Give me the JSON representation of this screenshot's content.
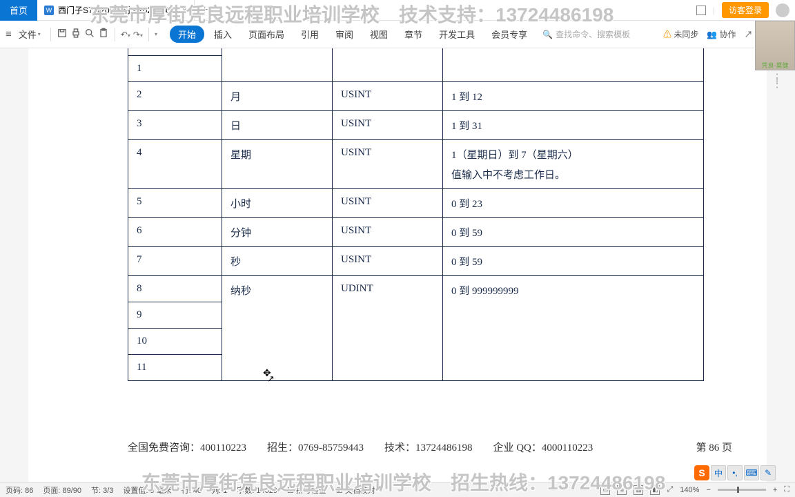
{
  "titlebar": {
    "home_tab": "首页",
    "doc_icon": "W",
    "doc_name": "西门子S7-1200教材 - 20210302",
    "login": "访客登录"
  },
  "toolbar": {
    "file": "文件",
    "tabs": {
      "start": "开始",
      "insert": "插入",
      "layout": "页面布局",
      "ref": "引用",
      "review": "审阅",
      "view": "视图",
      "chapter": "章节",
      "dev": "开发工具",
      "member": "会员专享"
    },
    "search_ph": "查找命令、搜索模板",
    "unsynced": "未同步",
    "collab": "协作",
    "share": "分享"
  },
  "watermark": {
    "top": "东莞市厚街凭良远程职业培训学校　技术支持：13724486198",
    "bottom": "东莞市厚街凭良远程职业培训学校　招生热线：13724486198"
  },
  "table": {
    "r1": {
      "c1": "1"
    },
    "r2": {
      "c1": "2",
      "c2": "月",
      "c3": "USINT",
      "c4": "1 到 12"
    },
    "r3": {
      "c1": "3",
      "c2": "日",
      "c3": "USINT",
      "c4": "1 到 31"
    },
    "r4": {
      "c1": "4",
      "c2": "星期",
      "c3": "USINT",
      "c4a": "1（星期日）到 7（星期六）",
      "c4b": "值输入中不考虑工作日。"
    },
    "r5": {
      "c1": "5",
      "c2": "小时",
      "c3": "USINT",
      "c4": "0 到 23"
    },
    "r6": {
      "c1": "6",
      "c2": "分钟",
      "c3": "USINT",
      "c4": "0 到 59"
    },
    "r7": {
      "c1": "7",
      "c2": "秒",
      "c3": "USINT",
      "c4": "0 到 59"
    },
    "r8": {
      "c1": "8",
      "c2": "纳秒",
      "c3": "UDINT",
      "c4": "0 到 999999999"
    },
    "r9": {
      "c1": "9"
    },
    "r10": {
      "c1": "10"
    },
    "r11": {
      "c1": "11"
    }
  },
  "footer": {
    "line": "全国免费咨询：400110223　　招生：0769-85759443　　技术：13724486198　　企业 QQ：4000110223",
    "page": "第  86  页"
  },
  "status": {
    "page_label": "页码: 86",
    "pages": "页面: 89/90",
    "section": "节: 3/3",
    "setval": "设置值: 9 毫米",
    "row": "行: 40",
    "col": "列: 1",
    "chars": "字数: 14629",
    "spell": "拼写检查",
    "doccheck": "文档校对",
    "zoom": "140%"
  },
  "ime": {
    "cn": "中",
    "punct": "•,",
    "kb": "⌨"
  },
  "avatar_caption": "凭良·莫健"
}
